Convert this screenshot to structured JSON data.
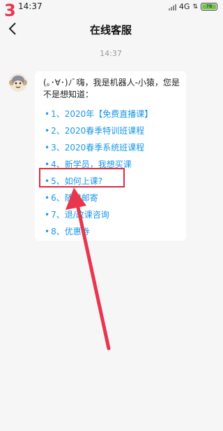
{
  "status_bar": {
    "step_number": "3",
    "time": "14:37",
    "network": "4G",
    "battery": "76"
  },
  "header": {
    "title": "在线客服"
  },
  "chat": {
    "timestamp": "14:37",
    "greeting": "(｡･∀･)ﾉﾞ嗨，我是机器人-小猿，您是不是想知道：",
    "options": [
      {
        "label": "1、2020年【免费直播课】"
      },
      {
        "label": "2、2020春季特训班课程"
      },
      {
        "label": "3、2020春季系统班课程"
      },
      {
        "label": "4、新学员，我想买课"
      },
      {
        "label": "5、如何上课?"
      },
      {
        "label": "6、随材邮寄"
      },
      {
        "label": "7、退/改课咨询"
      },
      {
        "label": "8、优惠券"
      }
    ]
  },
  "colors": {
    "annotation": "#e02a3a",
    "link": "#1a97e8"
  }
}
